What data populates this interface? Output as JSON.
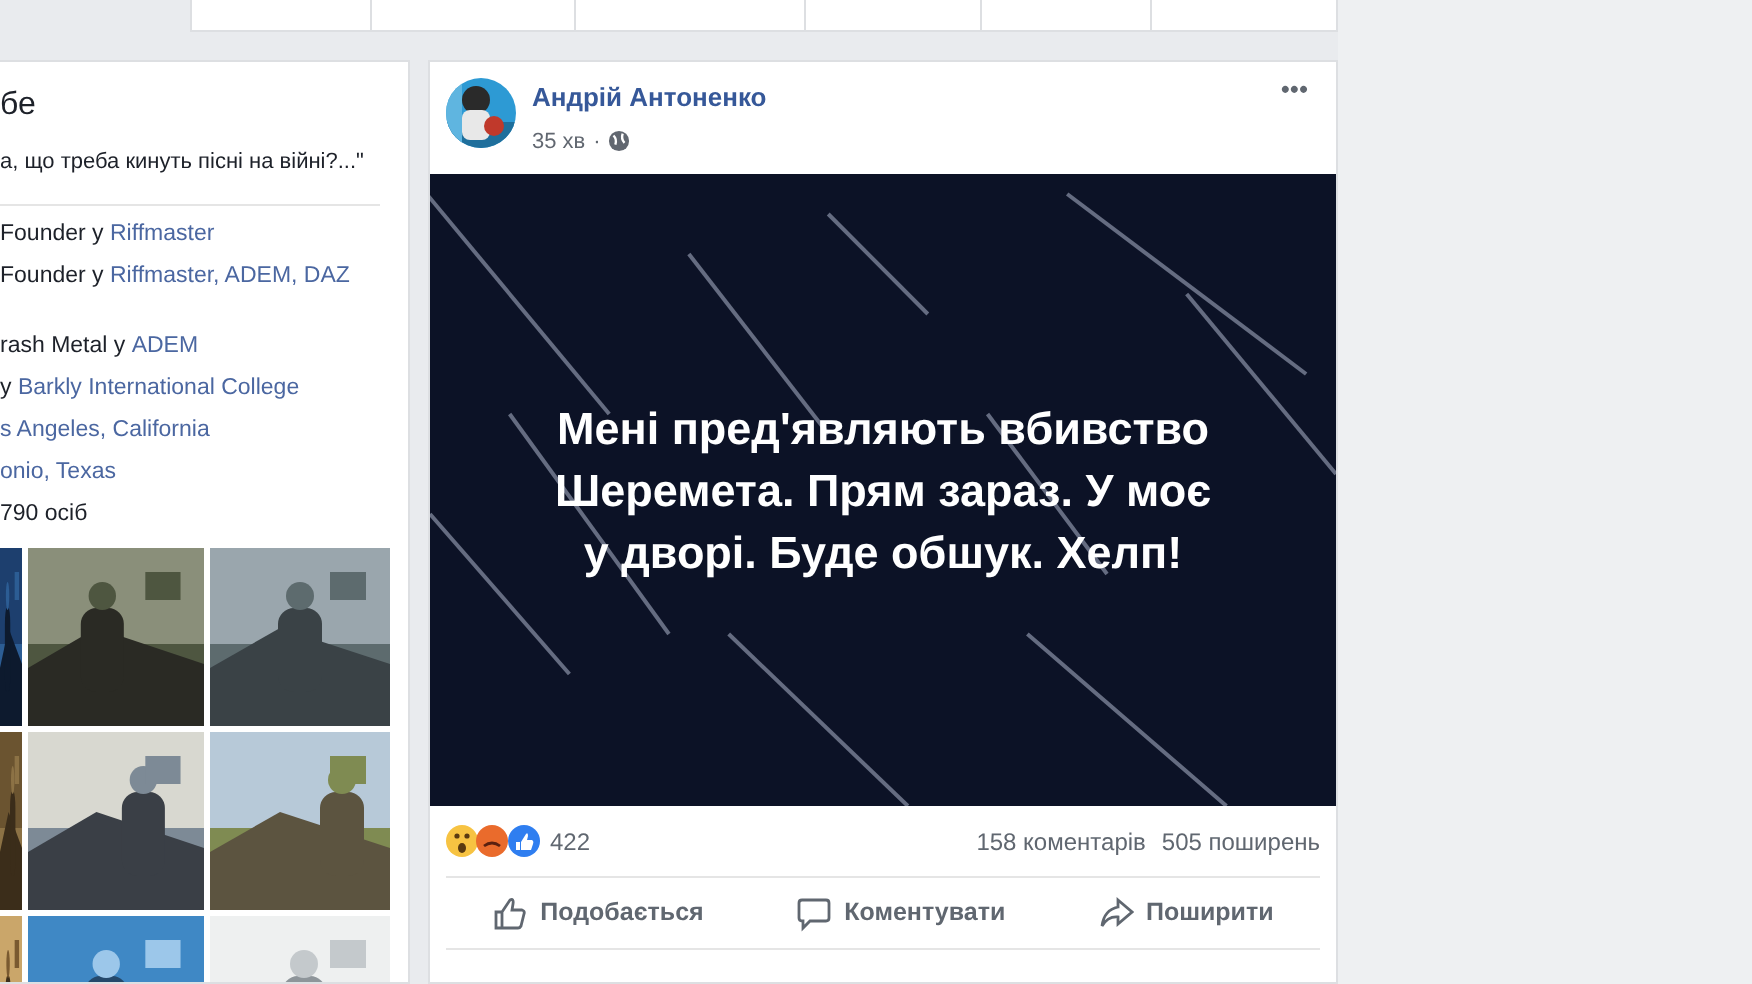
{
  "about": {
    "heading": "бе",
    "quote": "а, що треба кинуть пісні на війні?...\"",
    "items": [
      {
        "prefix": "Founder у ",
        "link": "Riffmaster"
      },
      {
        "prefix": "Founder у ",
        "link": "Riffmaster, ADEM, DAZ"
      },
      {
        "prefix": "rash Metal у ",
        "link": "ADEM",
        "gap": true
      },
      {
        "prefix": "у ",
        "link": "Barkly International College"
      },
      {
        "link": "s Angeles, California"
      },
      {
        "link": "onio, Texas"
      },
      {
        "prefix": "790 осіб"
      }
    ]
  },
  "post": {
    "author": "Андрій Антоненко",
    "time": "35 хв",
    "separator": "·",
    "menu": "•••",
    "text_lines": [
      "Мені пред'являють вбивство",
      "Шеремета. Прям зараз. У моє",
      "у дворі. Буде обшук. Хелп!"
    ],
    "reactions": {
      "count": "422",
      "comments": "158 коментарів",
      "shares": "505 поширень"
    },
    "actions": [
      {
        "kind": "like",
        "label": "Подобається"
      },
      {
        "kind": "comment",
        "label": "Коментувати"
      },
      {
        "kind": "share",
        "label": "Поширити"
      }
    ]
  }
}
